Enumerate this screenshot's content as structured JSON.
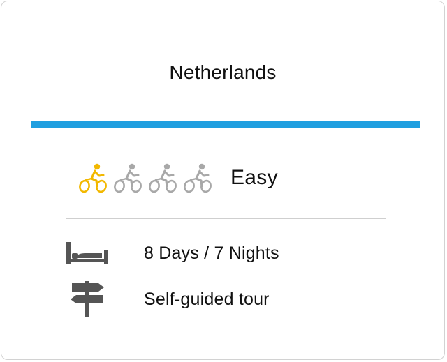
{
  "card": {
    "title": "Netherlands",
    "accent_color": "#1f9fe0"
  },
  "difficulty": {
    "level": 1,
    "max_level": 4,
    "label": "Easy",
    "active_color": "#f2b800",
    "inactive_color": "#a8a8a8",
    "icon": "cyclist-icon"
  },
  "details": {
    "duration": {
      "icon": "bed-icon",
      "text": "8 Days / 7 Nights"
    },
    "tour_type": {
      "icon": "signpost-icon",
      "text": "Self-guided tour"
    }
  }
}
